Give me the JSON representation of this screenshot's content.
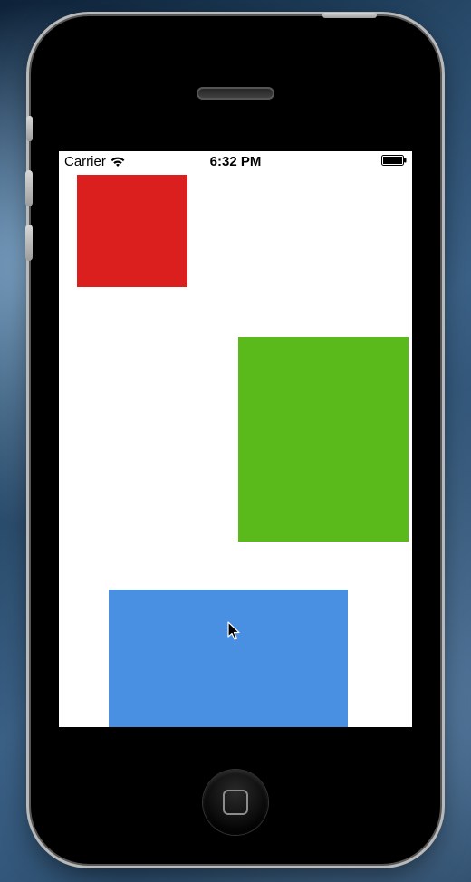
{
  "status_bar": {
    "carrier": "Carrier",
    "time": "6:32 PM"
  },
  "boxes": {
    "red": {
      "color": "#db1e1e"
    },
    "green": {
      "color": "#5bba1b"
    },
    "blue": {
      "color": "#4a90e2"
    }
  }
}
